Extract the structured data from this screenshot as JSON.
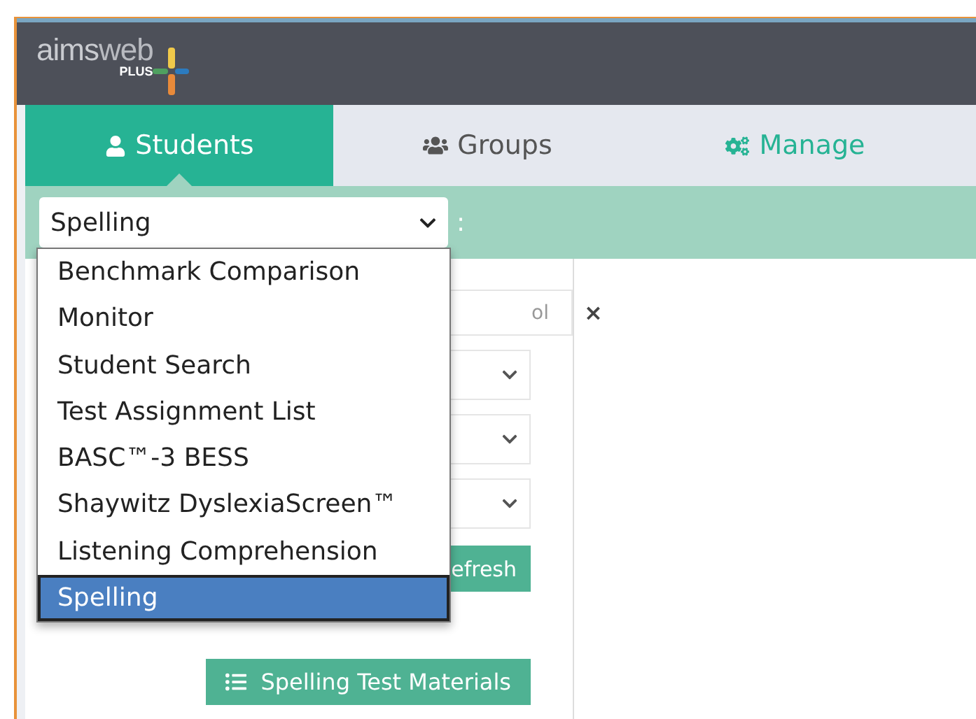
{
  "header": {
    "logo": {
      "main": "aims",
      "thin": "web",
      "sub": "PLUS"
    }
  },
  "tabs": [
    {
      "label": "Students",
      "kind": "person",
      "selected": true
    },
    {
      "label": "Groups",
      "kind": "group",
      "selected": false
    },
    {
      "label": "Manage",
      "kind": "settings",
      "selected": false
    }
  ],
  "view_select": {
    "value": "Spelling",
    "suffix": ":",
    "expanded": true,
    "options": [
      {
        "label": "Benchmark Comparison",
        "selected": false
      },
      {
        "label": "Monitor",
        "selected": false
      },
      {
        "label": "Student Search",
        "selected": false
      },
      {
        "label": "Test Assignment List",
        "selected": false
      },
      {
        "label": "BASC™-3 BESS",
        "selected": false
      },
      {
        "label": "Shaywitz DyslexiaScreen™",
        "selected": false
      },
      {
        "label": "Listening Comprehension",
        "selected": false
      },
      {
        "label": "Spelling",
        "selected": true
      }
    ]
  },
  "filters": {
    "school_field": {
      "value": "ol",
      "clear": "×"
    },
    "refresh_button": "efresh"
  },
  "materials_button": "Spelling Test Materials"
}
